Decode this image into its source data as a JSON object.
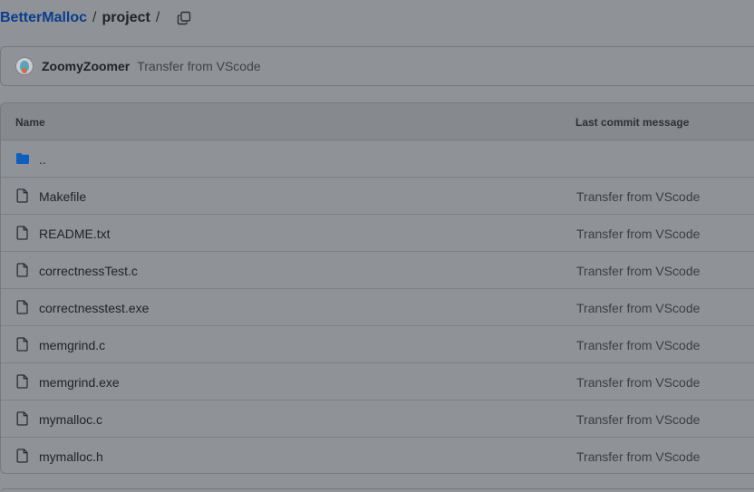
{
  "breadcrumb": {
    "repo": "BetterMalloc",
    "separator": "/",
    "directory": "project",
    "trailing_separator": "/",
    "copy_icon": "copy-icon"
  },
  "latest_commit": {
    "author": "ZoomyZoomer",
    "message": "Transfer from VScode"
  },
  "file_table": {
    "headers": {
      "name": "Name",
      "last_commit_message": "Last commit message"
    },
    "rows": [
      {
        "name": "..",
        "type": "folder",
        "icon": "folder-icon",
        "message": ""
      },
      {
        "name": "Makefile",
        "type": "file",
        "icon": "file-icon",
        "message": "Transfer from VScode"
      },
      {
        "name": "README.txt",
        "type": "file",
        "icon": "file-icon",
        "message": "Transfer from VScode"
      },
      {
        "name": "correctnessTest.c",
        "type": "file",
        "icon": "file-icon",
        "message": "Transfer from VScode"
      },
      {
        "name": "correctnesstest.exe",
        "type": "file",
        "icon": "file-icon",
        "message": "Transfer from VScode"
      },
      {
        "name": "memgrind.c",
        "type": "file",
        "icon": "file-icon",
        "message": "Transfer from VScode"
      },
      {
        "name": "memgrind.exe",
        "type": "file",
        "icon": "file-icon",
        "message": "Transfer from VScode"
      },
      {
        "name": "mymalloc.c",
        "type": "file",
        "icon": "file-icon",
        "message": "Transfer from VScode"
      },
      {
        "name": "mymalloc.h",
        "type": "file",
        "icon": "file-icon",
        "message": "Transfer from VScode"
      }
    ]
  },
  "colors": {
    "overlay_background": "#8f9296",
    "link": "#0a3d91",
    "folder": "#0d5fbf"
  }
}
